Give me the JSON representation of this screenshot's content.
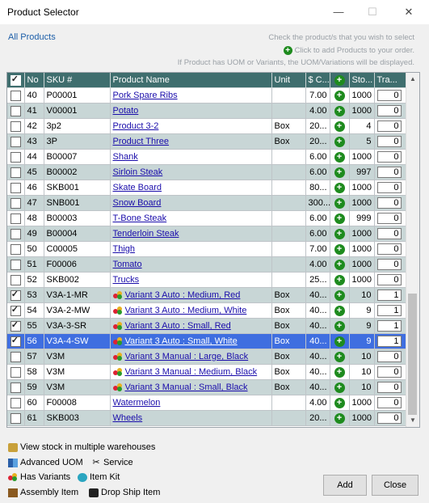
{
  "window": {
    "title": "Product Selector",
    "minimize": "—",
    "maximize": "☐",
    "close": "✕"
  },
  "header": {
    "all_products": "All Products",
    "hint_check": "Check the product/s that you wish to select",
    "hint_add": "Click to add Products to your order.",
    "hint_uom": "If Product has UOM or Variants, the UOM/Variations will be displayed."
  },
  "columns": [
    "No",
    "SKU #",
    "Product Name",
    "Unit",
    "$ C...",
    "",
    "Sto...",
    "Tra..."
  ],
  "rows": [
    {
      "checked": false,
      "no": "40",
      "sku": "P00001",
      "name": "Pork Spare Ribs",
      "unit": "",
      "cost": "7.00",
      "stock": "1000",
      "qty": "0",
      "variant": false
    },
    {
      "checked": false,
      "no": "41",
      "sku": "V00001",
      "name": "Potato",
      "unit": "",
      "cost": "4.00",
      "stock": "1000",
      "qty": "0",
      "variant": false
    },
    {
      "checked": false,
      "no": "42",
      "sku": "3p2",
      "name": "Product 3-2",
      "unit": "Box",
      "cost": "20...",
      "stock": "4",
      "qty": "0",
      "variant": false
    },
    {
      "checked": false,
      "no": "43",
      "sku": "3P",
      "name": "Product Three",
      "unit": "Box",
      "cost": "20...",
      "stock": "5",
      "qty": "0",
      "variant": false
    },
    {
      "checked": false,
      "no": "44",
      "sku": "B00007",
      "name": "Shank",
      "unit": "",
      "cost": "6.00",
      "stock": "1000",
      "qty": "0",
      "variant": false
    },
    {
      "checked": false,
      "no": "45",
      "sku": "B00002",
      "name": "Sirloin Steak",
      "unit": "",
      "cost": "6.00",
      "stock": "997",
      "qty": "0",
      "variant": false
    },
    {
      "checked": false,
      "no": "46",
      "sku": "SKB001",
      "name": "Skate Board",
      "unit": "",
      "cost": "80...",
      "stock": "1000",
      "qty": "0",
      "variant": false
    },
    {
      "checked": false,
      "no": "47",
      "sku": "SNB001",
      "name": "Snow Board",
      "unit": "",
      "cost": "300...",
      "stock": "1000",
      "qty": "0",
      "variant": false
    },
    {
      "checked": false,
      "no": "48",
      "sku": "B00003",
      "name": "T-Bone Steak",
      "unit": "",
      "cost": "6.00",
      "stock": "999",
      "qty": "0",
      "variant": false
    },
    {
      "checked": false,
      "no": "49",
      "sku": "B00004",
      "name": "Tenderloin Steak",
      "unit": "",
      "cost": "6.00",
      "stock": "1000",
      "qty": "0",
      "variant": false
    },
    {
      "checked": false,
      "no": "50",
      "sku": "C00005",
      "name": "Thigh",
      "unit": "",
      "cost": "7.00",
      "stock": "1000",
      "qty": "0",
      "variant": false
    },
    {
      "checked": false,
      "no": "51",
      "sku": "F00006",
      "name": "Tomato",
      "unit": "",
      "cost": "4.00",
      "stock": "1000",
      "qty": "0",
      "variant": false
    },
    {
      "checked": false,
      "no": "52",
      "sku": "SKB002",
      "name": "Trucks",
      "unit": "",
      "cost": "25...",
      "stock": "1000",
      "qty": "0",
      "variant": false
    },
    {
      "checked": true,
      "no": "53",
      "sku": "V3A-1-MR",
      "name": "Variant 3 Auto : Medium, Red",
      "unit": "Box",
      "cost": "40...",
      "stock": "10",
      "qty": "1",
      "variant": true
    },
    {
      "checked": true,
      "no": "54",
      "sku": "V3A-2-MW",
      "name": "Variant 3 Auto : Medium, White",
      "unit": "Box",
      "cost": "40...",
      "stock": "9",
      "qty": "1",
      "variant": true
    },
    {
      "checked": true,
      "no": "55",
      "sku": "V3A-3-SR",
      "name": "Variant 3 Auto : Small, Red",
      "unit": "Box",
      "cost": "40...",
      "stock": "9",
      "qty": "1",
      "variant": true
    },
    {
      "checked": true,
      "no": "56",
      "sku": "V3A-4-SW",
      "name": "Variant 3 Auto : Small, White",
      "unit": "Box",
      "cost": "40...",
      "stock": "9",
      "qty": "1",
      "variant": true,
      "selected": true
    },
    {
      "checked": false,
      "no": "57",
      "sku": "V3M",
      "name": "Variant 3 Manual : Large, Black",
      "unit": "Box",
      "cost": "40...",
      "stock": "10",
      "qty": "0",
      "variant": true
    },
    {
      "checked": false,
      "no": "58",
      "sku": "V3M",
      "name": "Variant 3 Manual : Medium, Black",
      "unit": "Box",
      "cost": "40...",
      "stock": "10",
      "qty": "0",
      "variant": true
    },
    {
      "checked": false,
      "no": "59",
      "sku": "V3M",
      "name": "Variant 3 Manual : Small, Black",
      "unit": "Box",
      "cost": "40...",
      "stock": "10",
      "qty": "0",
      "variant": true
    },
    {
      "checked": false,
      "no": "60",
      "sku": "F00008",
      "name": "Watermelon",
      "unit": "",
      "cost": "4.00",
      "stock": "1000",
      "qty": "0",
      "variant": false
    },
    {
      "checked": false,
      "no": "61",
      "sku": "SKB003",
      "name": "Wheels",
      "unit": "",
      "cost": "20...",
      "stock": "1000",
      "qty": "0",
      "variant": false
    }
  ],
  "legend": {
    "stock": "View stock in multiple warehouses",
    "uom": "Advanced UOM",
    "service": "Service",
    "variants": "Has Variants",
    "kit": "Item Kit",
    "assembly": "Assembly Item",
    "dropship": "Drop Ship Item"
  },
  "buttons": {
    "add": "Add",
    "close": "Close"
  },
  "colors": {
    "header": "#3f6e6e",
    "alt_row": "#c8d6d6",
    "selected": "#3f6ee0",
    "link": "#1a0dab",
    "add_icon": "#1e8b1e"
  }
}
